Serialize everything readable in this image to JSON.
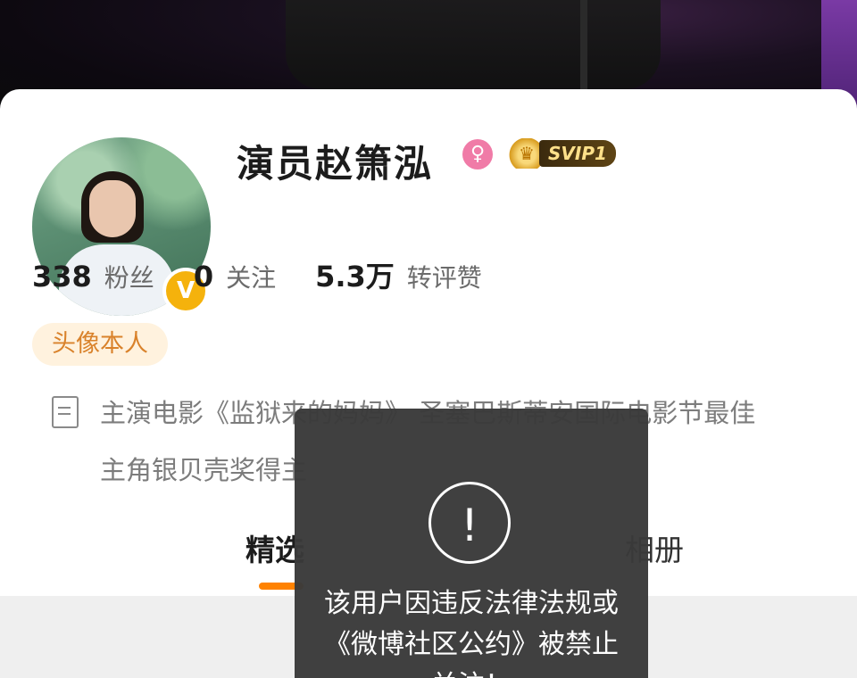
{
  "profile": {
    "name": "演员赵箫泓",
    "gender_icon": "female-icon",
    "svip_label": "SVIP1",
    "verified_icon": "verified-v-icon",
    "verified_mark": "V"
  },
  "stats": [
    {
      "value": "338",
      "label": "粉丝"
    },
    {
      "value": "0",
      "label": "关注"
    },
    {
      "value": "5.3万",
      "label": "转评赞"
    }
  ],
  "tag": "头像本人",
  "bio": {
    "icon": "document-icon",
    "line1": "主演电影《监狱来的妈妈》 圣塞巴斯蒂安国际电影节最佳",
    "line2": "主角银贝壳奖得主"
  },
  "tabs": {
    "selected": "精选",
    "album": "相册"
  },
  "toast": {
    "icon": "exclamation-icon",
    "icon_glyph": "!",
    "message": "该用户因违反法律法规或《微博社区公约》被禁止关注！"
  },
  "colors": {
    "accent_orange": "#ff8200",
    "verified_gold": "#f5b20c",
    "tag_bg": "#fff2de",
    "tag_text": "#d9822b",
    "gender_pink": "#f07ba7"
  }
}
